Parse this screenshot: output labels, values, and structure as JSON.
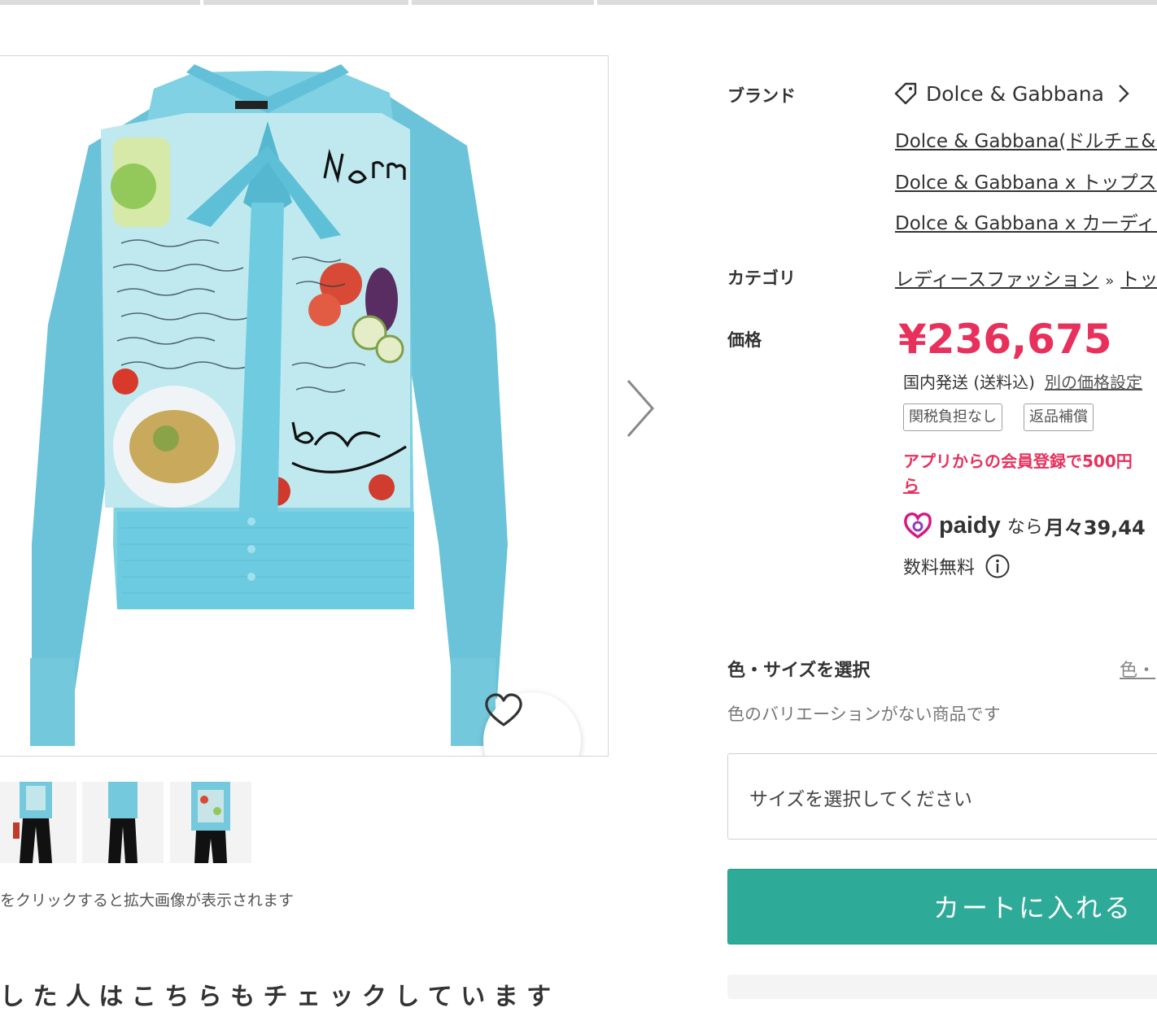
{
  "gallery": {
    "thumbnail_hint": "をクリックすると拡大画像が表示されます",
    "bottom_heading_partial": "し た 人 は こ ち ら も チ ェ ッ ク し て い ま す"
  },
  "product": {
    "brand_label": "ブランド",
    "brand_name": "Dolce & Gabbana",
    "brand_links": [
      "Dolce & Gabbana(ドルチェ&ガ",
      "Dolce & Gabbana x トップス",
      "Dolce & Gabbana x カーディガ"
    ],
    "category_label": "カテゴリ",
    "category_path": [
      "レディースファッション",
      "トップ"
    ],
    "category_separator": "»",
    "price_label": "価格",
    "price": "¥236,675",
    "shipping": "国内発送 (送料込)",
    "other_price_link": "別の価格設定",
    "badges": [
      "関税負担なし",
      "返品補償"
    ],
    "promo_line1": "アプリからの会員登録で500円",
    "promo_line2": "ら",
    "paidy_word": "paidy",
    "paidy_nara": "なら",
    "paidy_monthly": "月々39,44",
    "fee_free": "数料無料"
  },
  "selection": {
    "heading": "色・サイズを選択",
    "guide_link": "色・",
    "no_color_variation": "色のバリエーションがない商品です",
    "size_placeholder": "サイズを選択してください",
    "cart_button": "カートに入れる"
  },
  "colors": {
    "accent_price": "#e8305c",
    "cart_green": "#2daa98",
    "paidy_magenta": "#d6177f"
  },
  "icons": [
    "heart-icon",
    "chevron-right-icon",
    "tag-icon",
    "paidy-logo-icon",
    "info-icon"
  ]
}
